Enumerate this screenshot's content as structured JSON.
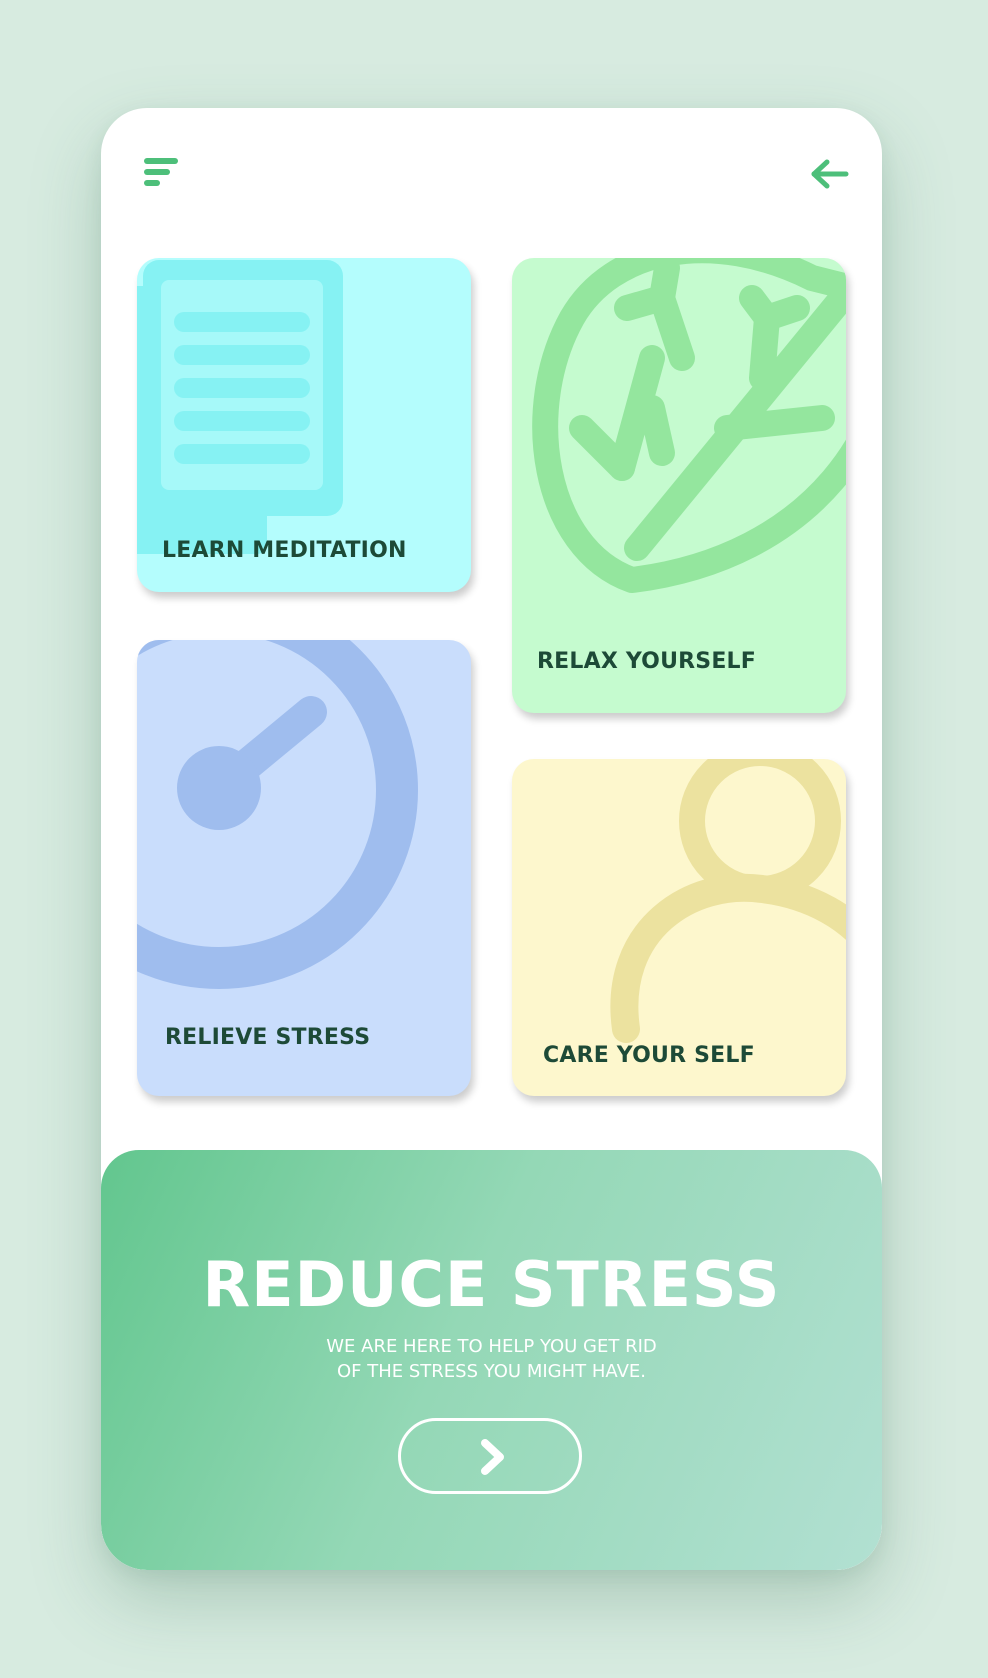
{
  "header": {
    "menu_icon": "menu-icon",
    "back_icon": "arrow-left-icon"
  },
  "cards": [
    {
      "label": "LEARN MEDITATION",
      "icon": "document-icon",
      "color": "#b4fdfd"
    },
    {
      "label": "RELAX YOURSELF",
      "icon": "leaf-icon",
      "color": "#c5fbcf"
    },
    {
      "label": "RELIEVE STRESS",
      "icon": "gauge-icon",
      "color": "#c9ddfc"
    },
    {
      "label": "CARE YOUR SELF",
      "icon": "person-icon",
      "color": "#fdf7cd"
    }
  ],
  "banner": {
    "title": "REDUCE STRESS",
    "subtitle_line1": "WE ARE HERE TO HELP YOU GET RID",
    "subtitle_line2": "OF THE STRESS YOU MIGHT HAVE.",
    "button_icon": "chevron-right-icon"
  },
  "colors": {
    "accent": "#4dbf7a",
    "label_text": "#1d4a37",
    "background": "#d7ebe0"
  }
}
